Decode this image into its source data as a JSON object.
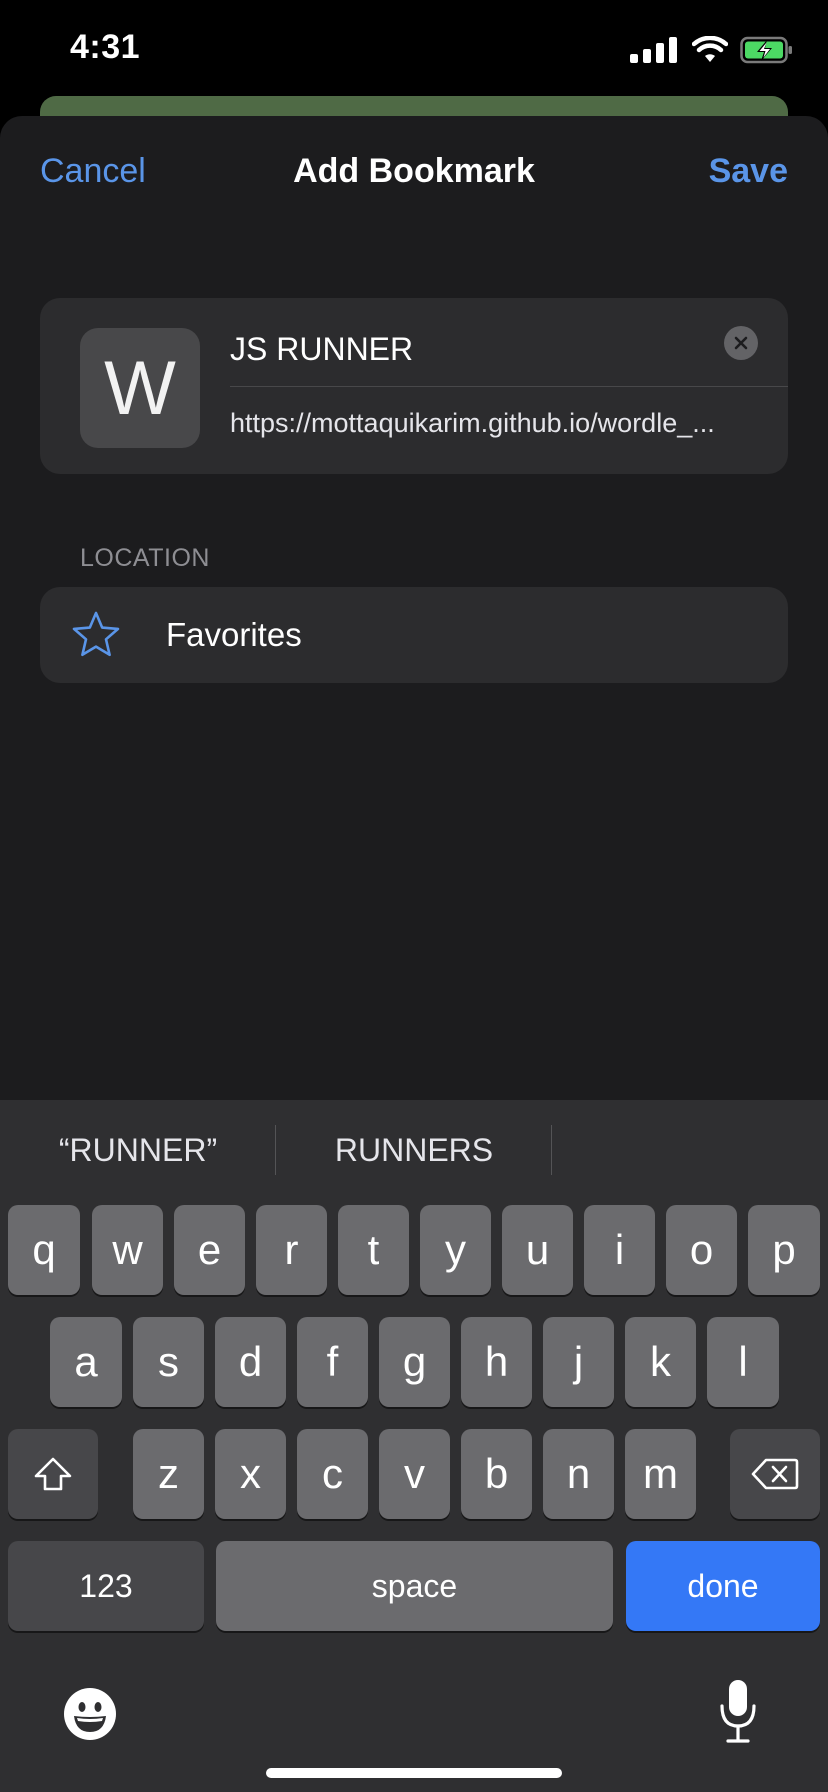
{
  "status_bar": {
    "time": "4:31"
  },
  "nav": {
    "cancel_label": "Cancel",
    "title": "Add Bookmark",
    "save_label": "Save"
  },
  "bookmark": {
    "favicon_letter": "W",
    "title_value": "JS RUNNER",
    "url_value": "https://mottaquikarim.github.io/wordle_..."
  },
  "location": {
    "section_label": "LOCATION",
    "value": "Favorites",
    "icon": "star-icon"
  },
  "keyboard": {
    "suggestions": [
      "“RUNNER”",
      "RUNNERS"
    ],
    "row1": [
      "q",
      "w",
      "e",
      "r",
      "t",
      "y",
      "u",
      "i",
      "o",
      "p"
    ],
    "row2": [
      "a",
      "s",
      "d",
      "f",
      "g",
      "h",
      "j",
      "k",
      "l"
    ],
    "row3": [
      "z",
      "x",
      "c",
      "v",
      "b",
      "n",
      "m"
    ],
    "numbers_label": "123",
    "space_label": "space",
    "done_label": "done"
  },
  "colors": {
    "accent": "#5a95e8",
    "done_key": "#3478f6",
    "sheet_bg": "#1c1c1e",
    "cell_bg": "#2c2c2e"
  }
}
